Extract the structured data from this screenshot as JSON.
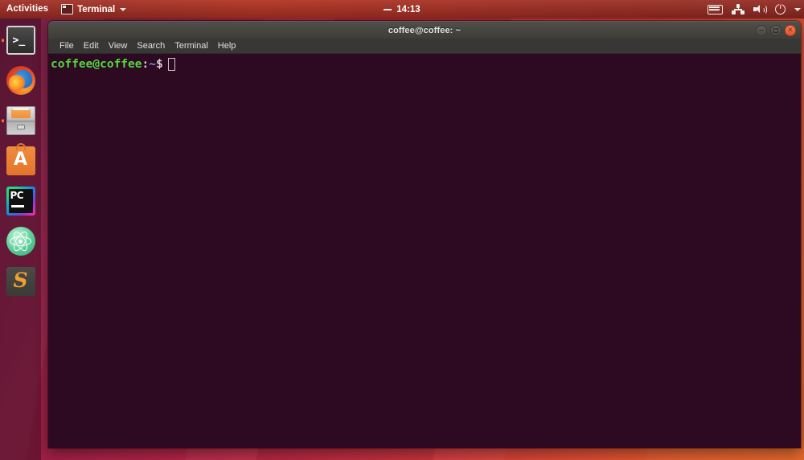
{
  "topbar": {
    "activities_label": "Activities",
    "app_menu": {
      "icon": "terminal-icon",
      "label": "Terminal",
      "caret": "chevron-down-icon"
    },
    "clock": "14:13",
    "clock_prefix_icon": "dash-icon",
    "indicators": [
      {
        "name": "keyboard-icon"
      },
      {
        "name": "network-icon"
      },
      {
        "name": "volume-icon"
      },
      {
        "name": "power-icon"
      },
      {
        "name": "chevron-down-icon"
      }
    ]
  },
  "dock": {
    "items": [
      {
        "label": "Terminal",
        "icon": "terminal-icon",
        "running": true
      },
      {
        "label": "Firefox",
        "icon": "firefox-icon",
        "running": false
      },
      {
        "label": "Files",
        "icon": "files-icon",
        "running": true
      },
      {
        "label": "Ubuntu Software",
        "icon": "ubuntu-software-icon",
        "running": false,
        "glyph": "A"
      },
      {
        "label": "PyCharm",
        "icon": "pycharm-icon",
        "running": false,
        "glyph": "PC"
      },
      {
        "label": "Atom",
        "icon": "atom-icon",
        "running": false
      },
      {
        "label": "Sublime Text",
        "icon": "sublime-text-icon",
        "running": false,
        "glyph": "S"
      }
    ]
  },
  "terminal": {
    "title": "coffee@coffee: ~",
    "window_buttons": [
      {
        "name": "minimize-button",
        "glyph": ""
      },
      {
        "name": "maximize-button",
        "glyph": ""
      },
      {
        "name": "close-button",
        "glyph": "×"
      }
    ],
    "menu": [
      "File",
      "Edit",
      "View",
      "Search",
      "Terminal",
      "Help"
    ],
    "prompt": {
      "user_host": "coffee@coffee",
      "colon": ":",
      "path": "~",
      "symbol": "$",
      "command": ""
    }
  },
  "colors": {
    "topbar": "#a82d20",
    "dock": "rgba(32,5,22,0.38)",
    "terminal_bg": "#2d0922",
    "prompt_green": "#4fd93f",
    "prompt_blue": "#7b8ef0",
    "close_button": "#e2502a",
    "accent_orange": "#e8763a"
  }
}
